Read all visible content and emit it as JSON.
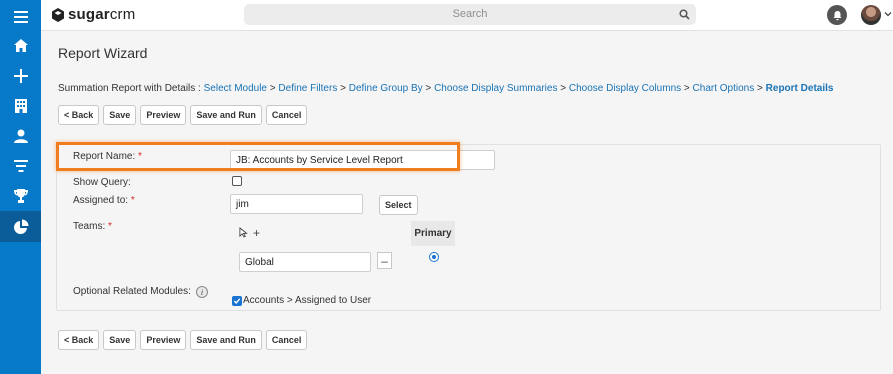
{
  "header": {
    "logo_text_bold": "sugar",
    "logo_text": "crm",
    "search_placeholder": "Search"
  },
  "page": {
    "title": "Report Wizard",
    "breadcrumb_prefix": "Summation Report with Details : ",
    "breadcrumb_steps": [
      "Select Module",
      "Define Filters",
      "Define Group By",
      "Choose Display Summaries",
      "Choose Display Columns",
      "Chart Options"
    ],
    "breadcrumb_separator": " > ",
    "breadcrumb_current": "Report Details"
  },
  "buttons": {
    "back": "< Back",
    "save": "Save",
    "preview": "Preview",
    "save_and_run": "Save and Run",
    "cancel": "Cancel"
  },
  "form": {
    "report_name_label": "Report Name:",
    "report_name_value": "JB: Accounts by Service Level Report",
    "show_query_label": "Show Query:",
    "assigned_to_label": "Assigned to:",
    "assigned_to_value": "jim",
    "select_button": "Select",
    "teams_label": "Teams:",
    "primary_header": "Primary",
    "team_value": "Global",
    "related_modules_label": "Optional Related Modules:",
    "related_module_option": "Accounts > Assigned to User",
    "required_marker": "*"
  },
  "colors": {
    "sidebar": "#0679c8",
    "link": "#1a73b5",
    "highlight": "#f07d1e",
    "required": "#d9252a"
  }
}
